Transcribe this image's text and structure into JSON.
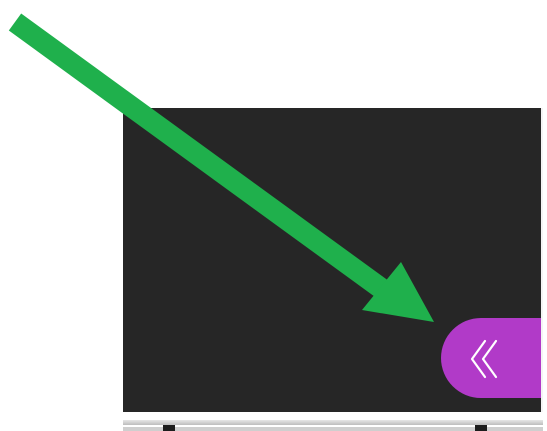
{
  "screen": {
    "panel_color": "#262626",
    "background_color": "#ffffff"
  },
  "collapse_tab": {
    "icon": "double-chevron-left-icon",
    "color": "#b13ac8",
    "icon_color": "#ffffff"
  },
  "annotation_arrow": {
    "icon": "arrow-pointer-icon",
    "color": "#1fb04c"
  }
}
